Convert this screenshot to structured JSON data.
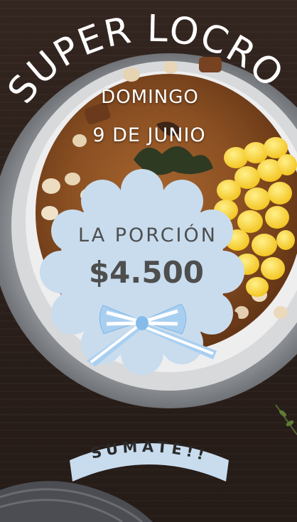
{
  "headline": "SUPER LOCRO",
  "event": {
    "day": "DOMINGO",
    "date": "9 DE JUNIO"
  },
  "price_badge": {
    "label": "LA PORCIÓN",
    "price": "$4.500"
  },
  "cta": "SUMATE!!",
  "colors": {
    "badge": "#c8dcee",
    "badge_text": "#4e4e4e",
    "ribbon_light": "#a9cff0",
    "ribbon_white": "#ffffff",
    "headline": "#ffffff"
  }
}
